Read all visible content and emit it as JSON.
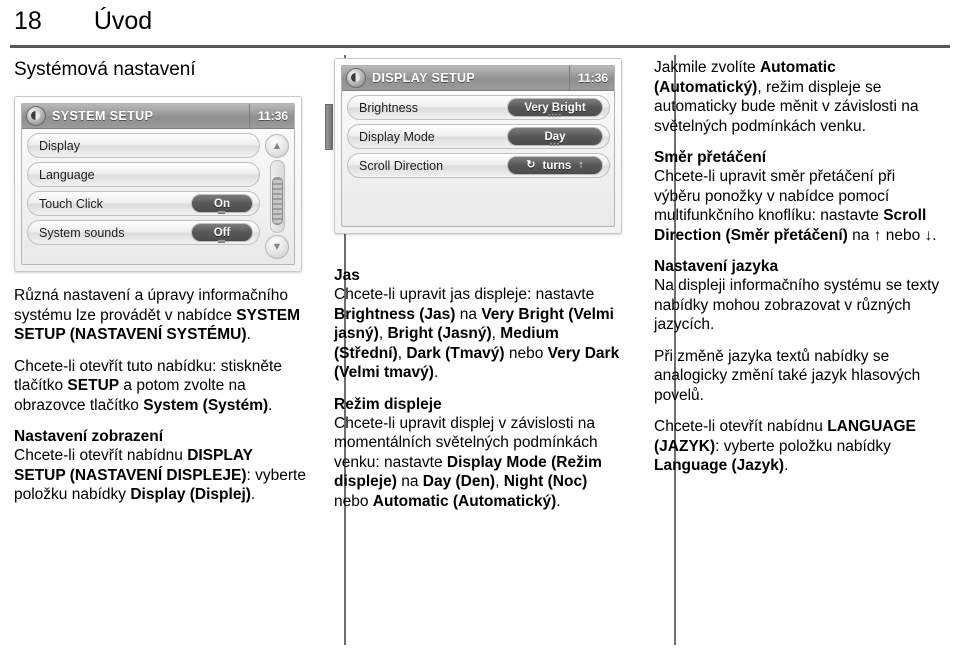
{
  "header": {
    "page_number": "18",
    "chapter": "Úvod"
  },
  "left_column": {
    "section_title": "Systémová nastavení",
    "device": {
      "icon": "gear-disc-icon",
      "title": "SYSTEM SETUP",
      "clock": "11:36",
      "rows": [
        {
          "label": "Display",
          "value": null
        },
        {
          "label": "Language",
          "value": null
        },
        {
          "label": "Touch Click",
          "value": "On"
        },
        {
          "label": "System sounds",
          "value": "Off"
        }
      ],
      "scroll_up_glyph": "▲",
      "scroll_down_glyph": "▼"
    },
    "paragraphs": [
      {
        "type": "body",
        "runs": [
          {
            "t": "Různá nastavení a úpravy informačního systému lze provádět v nabídce ",
            "b": false
          },
          {
            "t": "SYSTEM SETUP (NASTAVENÍ SYSTÉMU)",
            "b": true
          },
          {
            "t": ".",
            "b": false
          }
        ]
      },
      {
        "type": "body",
        "runs": [
          {
            "t": "Chcete-li otevřít tuto nabídku: stiskněte tlačítko ",
            "b": false
          },
          {
            "t": "SETUP",
            "b": true
          },
          {
            "t": " a potom zvolte na obrazovce tlačítko ",
            "b": false
          },
          {
            "t": "System (Systém)",
            "b": true
          },
          {
            "t": ".",
            "b": false
          }
        ]
      },
      {
        "type": "heading",
        "text": "Nastavení zobrazení"
      },
      {
        "type": "body",
        "runs": [
          {
            "t": "Chcete-li otevřít nabídnu ",
            "b": false
          },
          {
            "t": "DISPLAY SETUP (NASTAVENÍ DISPLEJE)",
            "b": true
          },
          {
            "t": ": vyberte položku nabídky ",
            "b": false
          },
          {
            "t": "Display (Displej)",
            "b": true
          },
          {
            "t": ".",
            "b": false
          }
        ]
      }
    ]
  },
  "middle_column": {
    "device": {
      "icon": "gear-disc-icon",
      "title": "DISPLAY SETUP",
      "clock": "11:36",
      "rows": [
        {
          "label": "Brightness",
          "value": "Very Bright"
        },
        {
          "label": "Display Mode",
          "value": "Day"
        },
        {
          "label": "Scroll Direction",
          "value": "turns",
          "left_glyph": "↻",
          "right_glyph": "↑"
        }
      ]
    },
    "paragraphs": [
      {
        "type": "heading",
        "text": "Jas"
      },
      {
        "type": "body",
        "runs": [
          {
            "t": "Chcete-li upravit jas displeje: nastavte ",
            "b": false
          },
          {
            "t": "Brightness (Jas)",
            "b": true
          },
          {
            "t": " na ",
            "b": false
          },
          {
            "t": "Very Bright (Velmi jasný)",
            "b": true
          },
          {
            "t": ", ",
            "b": false
          },
          {
            "t": "Bright (Jasný)",
            "b": true
          },
          {
            "t": ", ",
            "b": false
          },
          {
            "t": "Medium (Střední)",
            "b": true
          },
          {
            "t": ", ",
            "b": false
          },
          {
            "t": "Dark (Tmavý)",
            "b": true
          },
          {
            "t": " nebo ",
            "b": false
          },
          {
            "t": "Very Dark (Velmi tmavý)",
            "b": true
          },
          {
            "t": ".",
            "b": false
          }
        ]
      },
      {
        "type": "heading",
        "text": "Režim displeje"
      },
      {
        "type": "body",
        "runs": [
          {
            "t": "Chcete-li upravit displej v závislosti na momentálních světelných podmínkách venku: nastavte ",
            "b": false
          },
          {
            "t": "Display Mode (Režim displeje)",
            "b": true
          },
          {
            "t": " na ",
            "b": false
          },
          {
            "t": "Day (Den)",
            "b": true
          },
          {
            "t": ", ",
            "b": false
          },
          {
            "t": "Night (Noc)",
            "b": true
          },
          {
            "t": " nebo ",
            "b": false
          },
          {
            "t": "Automatic (Automatický)",
            "b": true
          },
          {
            "t": ".",
            "b": false
          }
        ]
      }
    ]
  },
  "right_column": {
    "paragraphs": [
      {
        "type": "body",
        "runs": [
          {
            "t": "Jakmile zvolíte ",
            "b": false
          },
          {
            "t": "Automatic (Automatický)",
            "b": true
          },
          {
            "t": ", režim displeje se automaticky bude měnit v závislosti na světelných podmínkách venku.",
            "b": false
          }
        ]
      },
      {
        "type": "heading",
        "text": "Směr přetáčení"
      },
      {
        "type": "body",
        "runs": [
          {
            "t": "Chcete-li upravit směr přetáčení při výběru ponožky v nabídce pomocí multifunkčního knoflíku: nastavte ",
            "b": false
          },
          {
            "t": "Scroll Direction (Směr přetáčení)",
            "b": true
          },
          {
            "t": " na ",
            "b": false
          },
          {
            "t": "↑",
            "b": true
          },
          {
            "t": " nebo ",
            "b": false
          },
          {
            "t": "↓",
            "b": true
          },
          {
            "t": ".",
            "b": false
          }
        ]
      },
      {
        "type": "heading",
        "text": "Nastavení jazyka"
      },
      {
        "type": "body",
        "runs": [
          {
            "t": "Na displeji informačního systému se texty nabídky mohou zobrazovat v různých jazycích.",
            "b": false
          }
        ]
      },
      {
        "type": "body",
        "runs": [
          {
            "t": "Při změně jazyka textů nabídky se analogicky změní také jazyk hlasových povelů.",
            "b": false
          }
        ]
      },
      {
        "type": "body",
        "runs": [
          {
            "t": "Chcete-li otevřít nabídnu ",
            "b": false
          },
          {
            "t": "LANGUAGE (JAZYK)",
            "b": true
          },
          {
            "t": ": vyberte položku nabídky ",
            "b": false
          },
          {
            "t": "Language (Jazyk)",
            "b": true
          },
          {
            "t": ".",
            "b": false
          }
        ]
      }
    ]
  },
  "colors": {
    "rule": "#58585c",
    "divider": "#6e6e72",
    "text": "#000000"
  }
}
